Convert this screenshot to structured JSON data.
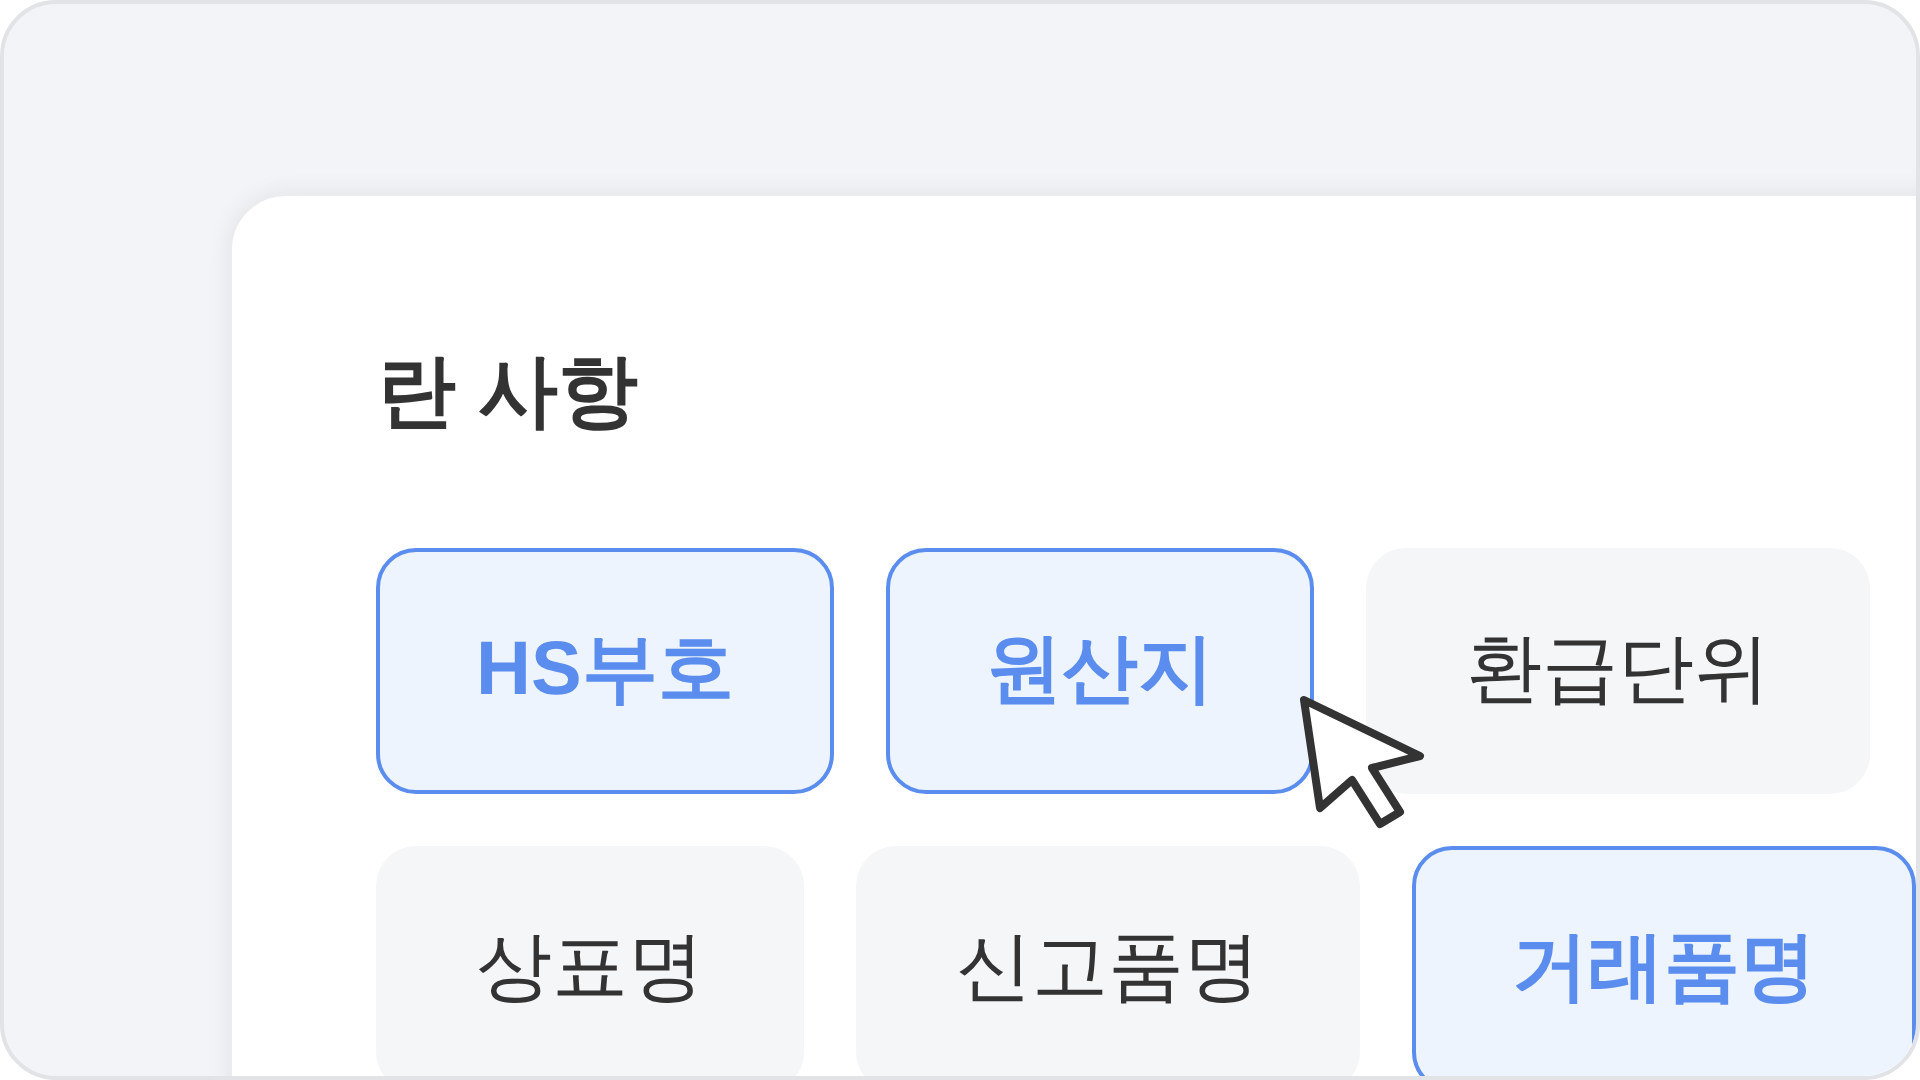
{
  "section": {
    "title": "란 사항"
  },
  "chips": [
    {
      "label": "HS부호",
      "selected": true
    },
    {
      "label": "원산지",
      "selected": true
    },
    {
      "label": "환급단위",
      "selected": false
    },
    {
      "label": "상표명",
      "selected": false
    },
    {
      "label": "신고품명",
      "selected": false
    },
    {
      "label": "거래품명",
      "selected": true
    }
  ]
}
